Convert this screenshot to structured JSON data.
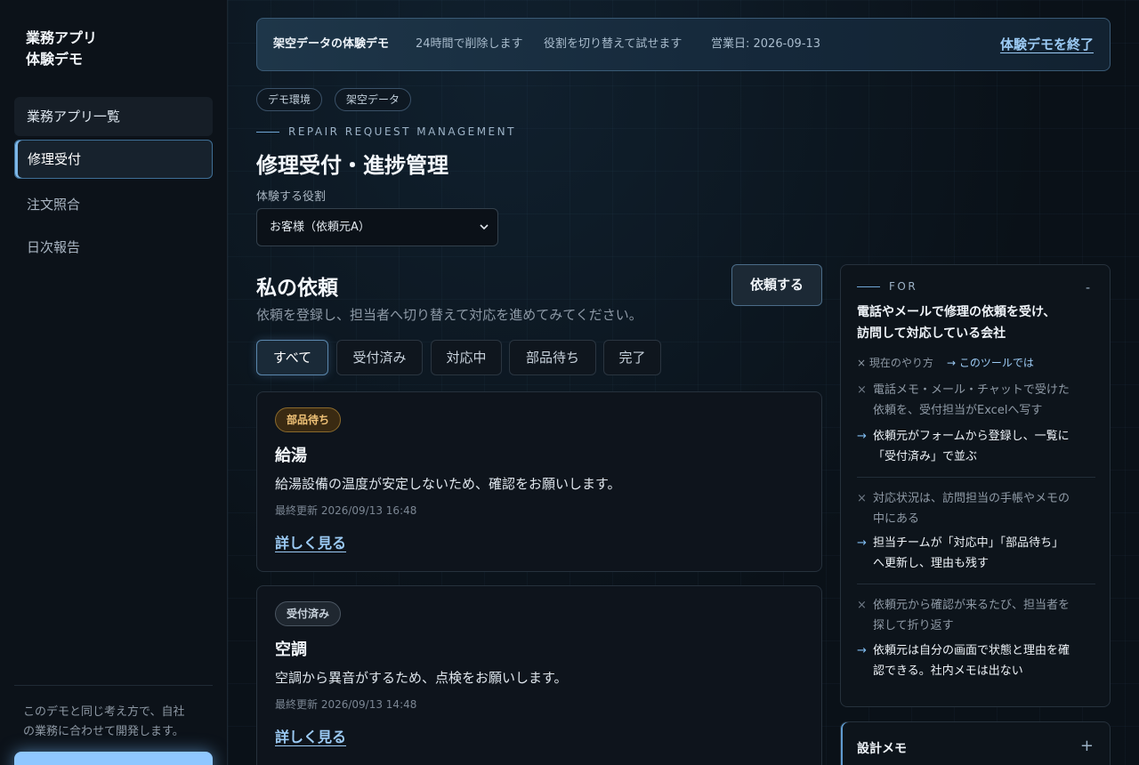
{
  "sidebar": {
    "brand_line1": "業務アプリ",
    "brand_line2": "体験デモ",
    "nav": [
      {
        "label": "業務アプリ一覧"
      },
      {
        "label": "修理受付"
      },
      {
        "label": "注文照合"
      },
      {
        "label": "日次報告"
      }
    ],
    "note_line1": "このデモと同じ考え方で、自社",
    "note_line2": "の業務に合わせて開発します。"
  },
  "banner": {
    "title": "架空データの体験デモ",
    "delete_notice": "24時間で削除します",
    "role_notice": "役割を切り替えて試せます",
    "business_date": "営業日: 2026-09-13",
    "end_label": "体験デモを終了"
  },
  "chips": [
    "デモ環境",
    "架空データ"
  ],
  "header": {
    "eyebrow": "REPAIR REQUEST MANAGEMENT",
    "title": "修理受付・進捗管理",
    "role_label": "体験する役割",
    "role_value": "お客様（依頼元A）"
  },
  "requests": {
    "title": "私の依頼",
    "description": "依頼を登録し、担当者へ切り替えて対応を進めてみてください。",
    "new_button": "依頼する",
    "filters": [
      "すべて",
      "受付済み",
      "対応中",
      "部品待ち",
      "完了"
    ],
    "active_filter": "すべて",
    "items": [
      {
        "status": "部品待ち",
        "title": "給湯",
        "description": "給湯設備の温度が安定しないため、確認をお願いします。",
        "updated": "最終更新 2026/09/13 16:48",
        "link": "詳しく見る"
      },
      {
        "status": "受付済み",
        "title": "空調",
        "description": "空調から異音がするため、点検をお願いします。",
        "updated": "最終更新 2026/09/13 14:48",
        "link": "詳しく見る"
      }
    ]
  },
  "for_panel": {
    "eyebrow": "FOR",
    "collapse_glyph": "-",
    "heading_line1": "電話やメールで修理の依頼を受け、",
    "heading_line2": "訪問して対応している会社",
    "legend_before": "× 現在のやり方",
    "legend_after": "→ このツールでは",
    "comparisons": [
      {
        "before_line1": "電話メモ・メール・チャットで受けた",
        "before_line2": "依頼を、受付担当がExcelへ写す",
        "after_line1": "依頼元がフォームから登録し、一覧に",
        "after_line2": "「受付済み」で並ぶ"
      },
      {
        "before_line1": "対応状況は、訪問担当の手帳やメモの",
        "before_line2": "中にある",
        "after_line1": "担当チームが「対応中」「部品待ち」",
        "after_line2": "へ更新し、理由も残す"
      },
      {
        "before_line1": "依頼元から確認が来るたび、担当者を",
        "before_line2": "探して折り返す",
        "after_line1": "依頼元は自分の画面で状態と理由を確",
        "after_line2": "認できる。社内メモは出ない"
      }
    ]
  },
  "memo_panel": {
    "title": "設計メモ",
    "expand_glyph": "+"
  },
  "glyphs": {
    "cross": "×",
    "arrow": "→",
    "chevron": "⌄"
  }
}
